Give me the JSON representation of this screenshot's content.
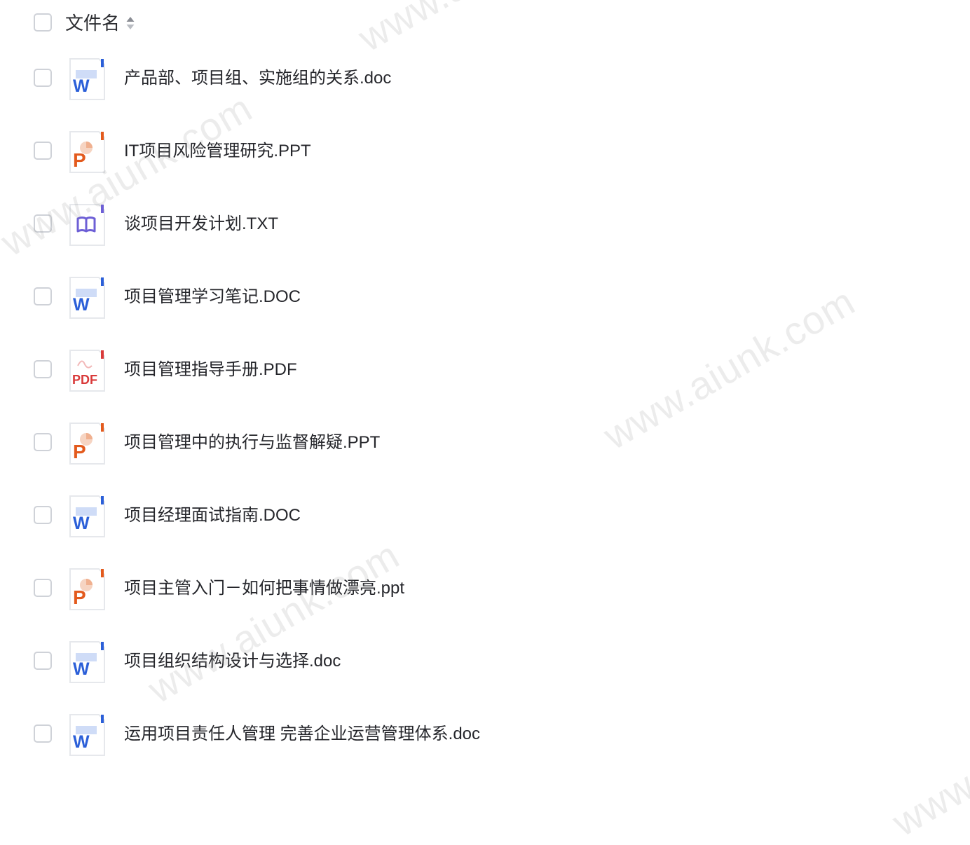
{
  "header": {
    "title": "文件名"
  },
  "watermark_text": "www.aiunk.com",
  "colors": {
    "word": "#2b5fd8",
    "ppt": "#e35a1d",
    "pdf": "#d93a3a",
    "txt": "#6d5fd6",
    "checkbox_border": "#cfd2d8"
  },
  "files": [
    {
      "name": "产品部、项目组、实施组的关系.doc",
      "type": "word",
      "icon": "word-file-icon"
    },
    {
      "name": "IT项目风险管理研究.PPT",
      "type": "ppt",
      "icon": "ppt-file-icon"
    },
    {
      "name": "谈项目开发计划.TXT",
      "type": "txt",
      "icon": "book-file-icon"
    },
    {
      "name": "项目管理学习笔记.DOC",
      "type": "word",
      "icon": "word-file-icon"
    },
    {
      "name": "项目管理指导手册.PDF",
      "type": "pdf",
      "icon": "pdf-file-icon"
    },
    {
      "name": "项目管理中的执行与监督解疑.PPT",
      "type": "ppt",
      "icon": "ppt-file-icon"
    },
    {
      "name": "项目经理面试指南.DOC",
      "type": "word",
      "icon": "word-file-icon"
    },
    {
      "name": "项目主管入门－如何把事情做漂亮.ppt",
      "type": "ppt",
      "icon": "ppt-file-icon"
    },
    {
      "name": "项目组织结构设计与选择.doc",
      "type": "word",
      "icon": "word-file-icon"
    },
    {
      "name": "运用项目责任人管理 完善企业运营管理体系.doc",
      "type": "word",
      "icon": "word-file-icon"
    }
  ]
}
